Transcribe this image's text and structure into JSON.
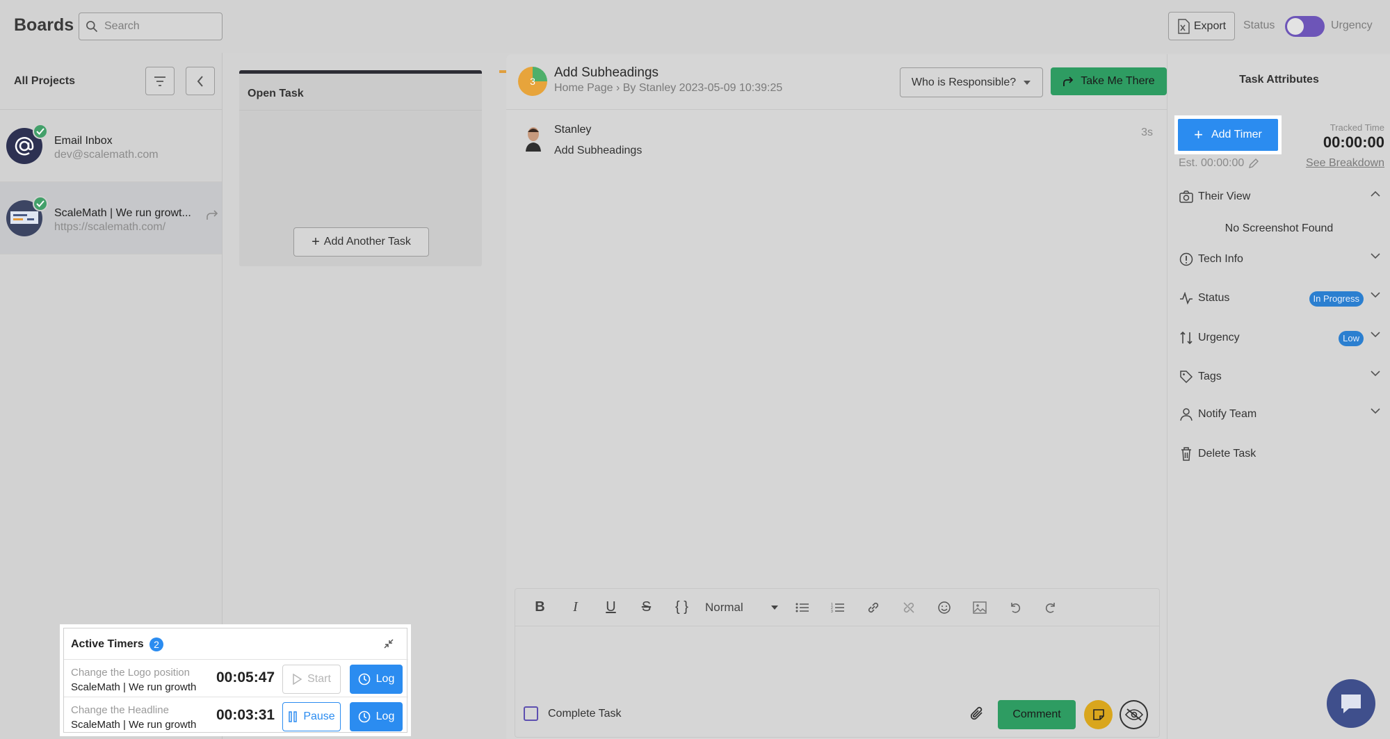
{
  "header": {
    "brand": "Boards",
    "search_placeholder": "Search",
    "export_label": "Export",
    "status_label": "Status",
    "urgency_label": "Urgency"
  },
  "sidebar": {
    "title": "All Projects",
    "projects": [
      {
        "name": "Email Inbox",
        "url": "dev@scalemath.com"
      },
      {
        "name": "ScaleMath | We run growt...",
        "url": "https://scalemath.com/"
      }
    ]
  },
  "board": {
    "column_title": "Open Task",
    "add_task_label": "Add Another Task"
  },
  "task": {
    "number": "3",
    "title": "Add Subheadings",
    "crumb_page": "Home Page",
    "crumb_by": "By Stanley 2023-05-09 10:39:25",
    "responsible_label": "Who is Responsible?",
    "take_me_label": "Take Me There",
    "comment": {
      "author": "Stanley",
      "text": "Add Subheadings",
      "time": "3s"
    }
  },
  "editor": {
    "format_label": "Normal",
    "complete_label": "Complete Task",
    "comment_label": "Comment"
  },
  "attributes": {
    "title": "Task Attributes",
    "add_timer_label": "Add Timer",
    "tracked_label": "Tracked Time",
    "tracked_value": "00:00:00",
    "est_label": "Est. 00:00:00",
    "breakdown_label": "See Breakdown",
    "their_view": "Their View",
    "no_screenshot": "No Screenshot Found",
    "tech_info": "Tech Info",
    "status": "Status",
    "status_value": "In Progress",
    "urgency": "Urgency",
    "urgency_value": "Low",
    "tags": "Tags",
    "notify": "Notify Team",
    "delete": "Delete Task"
  },
  "timers": {
    "title": "Active Timers",
    "count": "2",
    "rows": [
      {
        "task": "Change the Logo position",
        "project": "ScaleMath | We run growth",
        "time": "00:05:47",
        "action": "Start",
        "log": "Log"
      },
      {
        "task": "Change the Headline",
        "project": "ScaleMath | We run growth",
        "time": "00:03:31",
        "action": "Pause",
        "log": "Log"
      }
    ]
  },
  "colors": {
    "accent_blue": "#2b8cf0",
    "green": "#2e9c62",
    "purple": "#6d55b8",
    "yellow": "#d9a61d"
  }
}
